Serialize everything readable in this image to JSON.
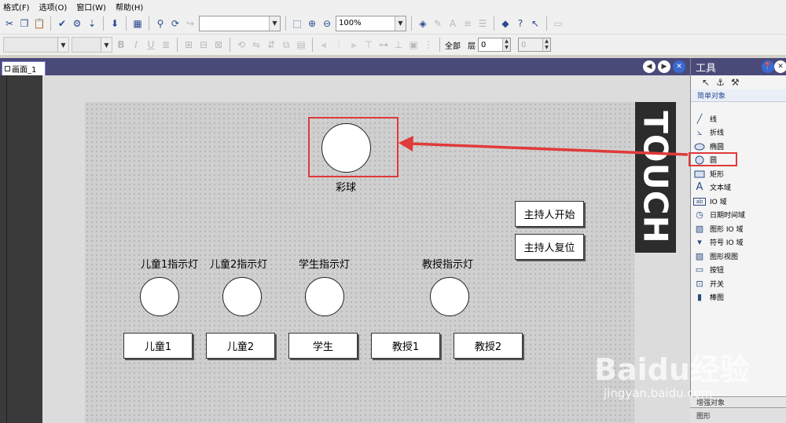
{
  "menu": [
    "格式(F)",
    "选项(O)",
    "窗口(W)",
    "帮助(H)"
  ],
  "toolbar": {
    "zoom_value": "100%",
    "layer_label_all": "全部",
    "layer_label": "层",
    "layer_value": "0",
    "layer_value_2": "0"
  },
  "tab": {
    "label": "画面_1"
  },
  "touch_logo": "TOUCH",
  "canvas": {
    "caiqiu_label": "彩球",
    "indicator_labels": [
      "儿童1指示灯",
      "儿童2指示灯",
      "学生指示灯",
      "教授指示灯"
    ],
    "buttons": [
      "儿童1",
      "儿童2",
      "学生",
      "教授1",
      "教授2"
    ],
    "host_start": "主持人开始",
    "host_reset": "主持人复位"
  },
  "tools": {
    "title": "工具",
    "section": "简单对象",
    "items": [
      "线",
      "折线",
      "椭圆",
      "圆",
      "矩形",
      "文本域",
      "IO 域",
      "日期时间域",
      "图形 IO 域",
      "符号 IO 域",
      "图形视图",
      "按钮",
      "开关",
      "棒图"
    ],
    "item_icons": [
      "line-icon",
      "polyline-icon",
      "ellipse-icon",
      "circle-icon",
      "rectangle-icon",
      "text-field-icon",
      "io-field-icon",
      "datetime-field-icon",
      "graphic-io-field-icon",
      "symbolic-io-field-icon",
      "graphic-view-icon",
      "button-icon",
      "switch-icon",
      "bar-icon"
    ],
    "footer_1": "增强对象",
    "footer_2": "图形"
  },
  "watermark": {
    "text": "Baidu经验",
    "url": "jingyan.baidu.com"
  },
  "colors": {
    "highlight": "#e03a3a",
    "titlebar": "#4a4a7a"
  }
}
